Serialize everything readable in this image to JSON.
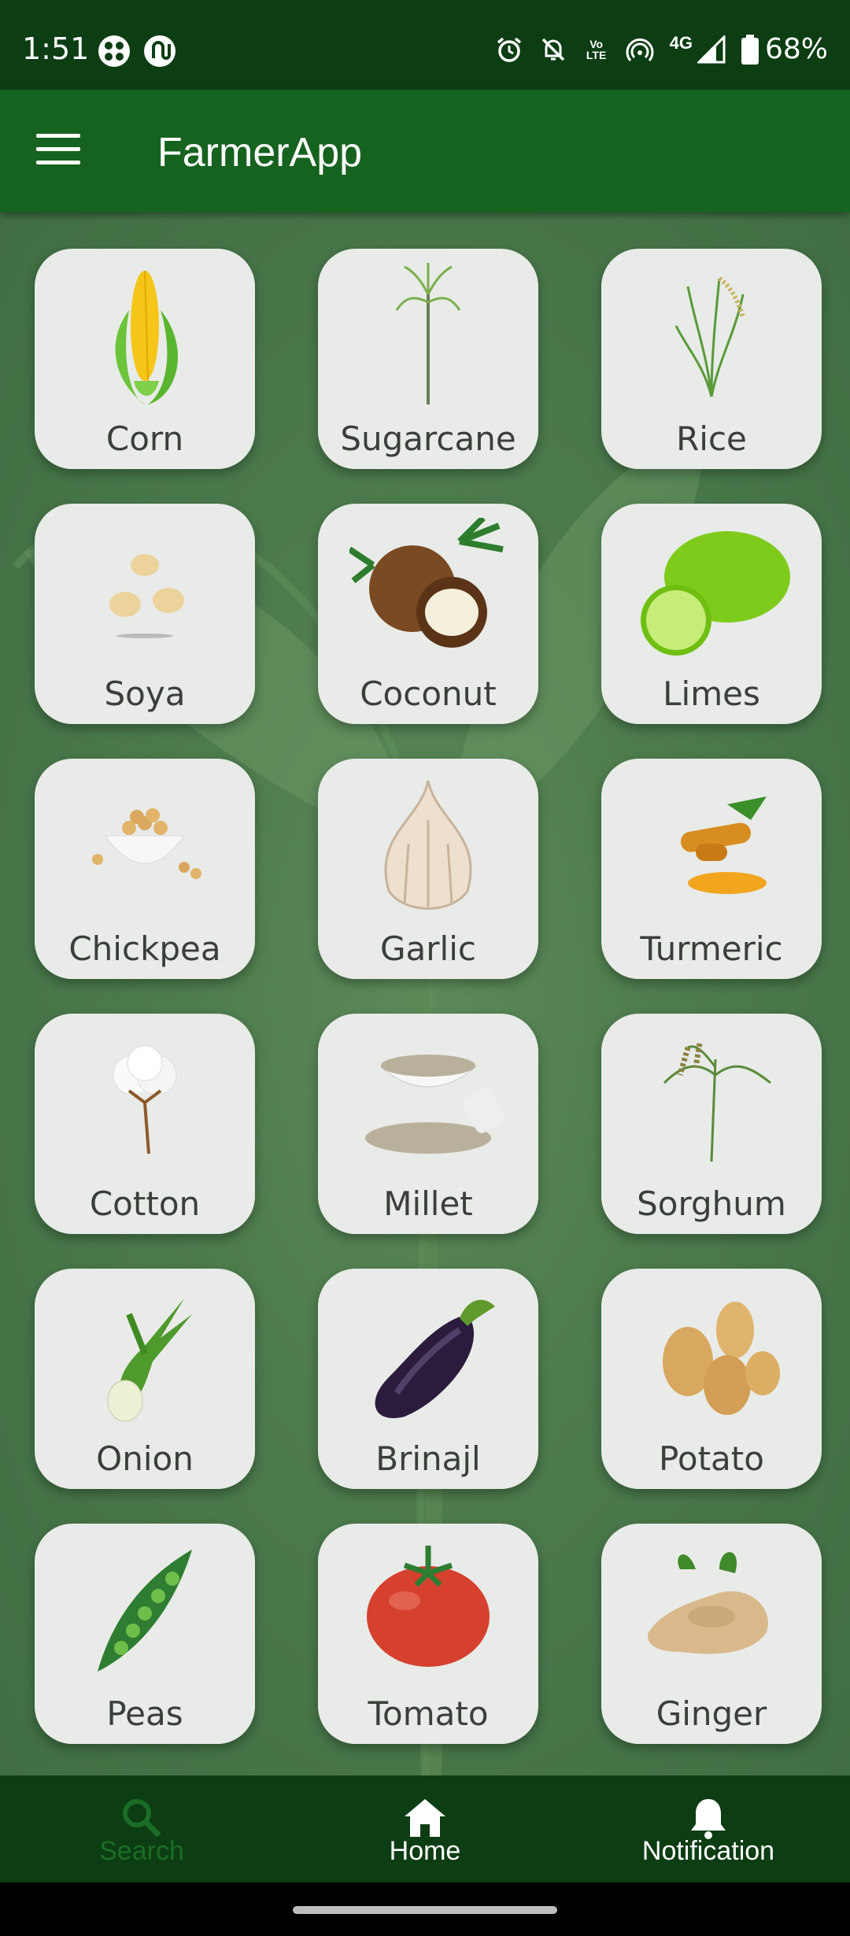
{
  "status_bar": {
    "time": "1:51",
    "battery": "68%",
    "network": "4G",
    "volte": "Vo LTE"
  },
  "app_bar": {
    "title": "FarmerApp"
  },
  "crops": [
    {
      "label": "Corn",
      "icon": "corn-icon"
    },
    {
      "label": "Sugarcane",
      "icon": "sugarcane-icon"
    },
    {
      "label": "Rice",
      "icon": "rice-icon"
    },
    {
      "label": "Soya",
      "icon": "soya-icon"
    },
    {
      "label": "Coconut",
      "icon": "coconut-icon"
    },
    {
      "label": "Limes",
      "icon": "limes-icon"
    },
    {
      "label": "Chickpea",
      "icon": "chickpea-icon"
    },
    {
      "label": "Garlic",
      "icon": "garlic-icon"
    },
    {
      "label": "Turmeric",
      "icon": "turmeric-icon"
    },
    {
      "label": "Cotton",
      "icon": "cotton-icon"
    },
    {
      "label": "Millet",
      "icon": "millet-icon"
    },
    {
      "label": "Sorghum",
      "icon": "sorghum-icon"
    },
    {
      "label": "Onion",
      "icon": "onion-icon"
    },
    {
      "label": "Brinajl",
      "icon": "brinjal-icon"
    },
    {
      "label": "Potato",
      "icon": "potato-icon"
    },
    {
      "label": "Peas",
      "icon": "peas-icon"
    },
    {
      "label": "Tomato",
      "icon": "tomato-icon"
    },
    {
      "label": "Ginger",
      "icon": "ginger-icon"
    }
  ],
  "bottom_nav": {
    "search": "Search",
    "home": "Home",
    "notification": "Notification"
  },
  "colors": {
    "status_bar": "#0c3d13",
    "app_bar": "#16621f",
    "card": "#e8ebe8",
    "inactive_nav": "#1a6d25"
  }
}
